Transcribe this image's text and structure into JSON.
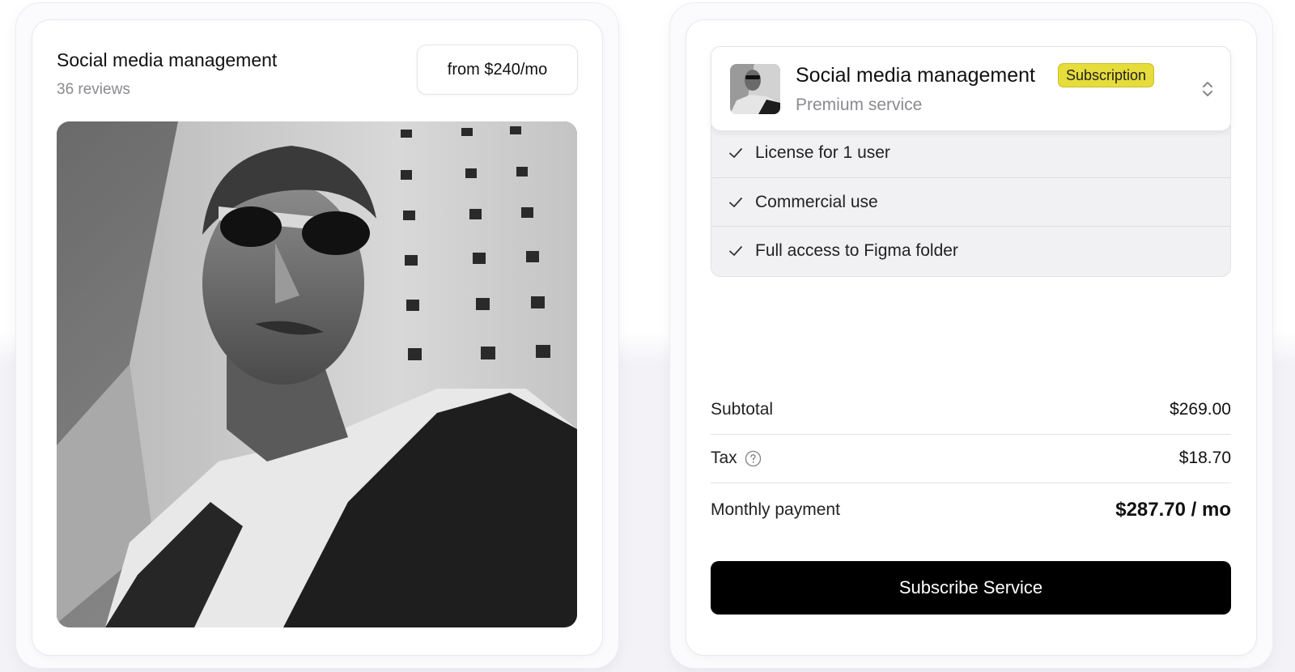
{
  "left_card": {
    "title": "Social media management",
    "reviews": "36 reviews",
    "price_button": "from $240/mo"
  },
  "right_card": {
    "selector": {
      "title": "Social media management",
      "badge": "Subscription",
      "subtitle": "Premium service"
    },
    "features": [
      {
        "label": "License for 1 user",
        "icon": "check-icon"
      },
      {
        "label": "Commercial use",
        "icon": "check-icon"
      },
      {
        "label": "Full access to Figma folder",
        "icon": "check-icon"
      }
    ],
    "summary": {
      "subtotal_label": "Subtotal",
      "subtotal_value": "$269.00",
      "tax_label": "Tax",
      "tax_value": "$18.70",
      "monthly_label": "Monthly payment",
      "monthly_value": "$287.70 / mo"
    },
    "subscribe_button": "Subscribe Service"
  },
  "colors": {
    "badge_bg": "#e6dc3b",
    "button_bg": "#000000",
    "muted_text": "#8a8a90",
    "features_bg": "#f1f1f4"
  },
  "icons": [
    "check-icon",
    "help-circle-icon",
    "chevron-up-down-icon"
  ]
}
